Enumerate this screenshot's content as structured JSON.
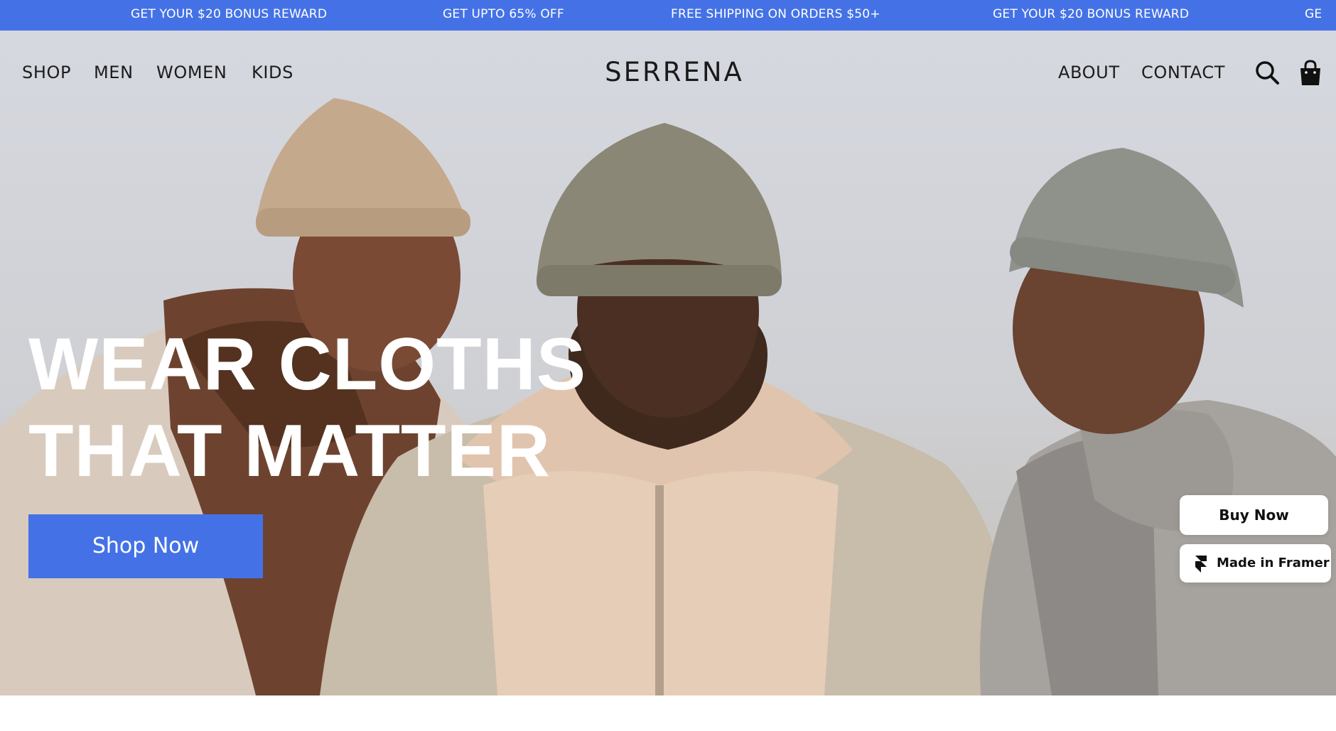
{
  "announcement_bar": {
    "messages": [
      "GET YOUR $20 BONUS REWARD",
      "GET UPTO 65% OFF",
      "FREE SHIPPING ON ORDERS $50+",
      "GET YOUR $20 BONUS REWARD",
      "GE"
    ],
    "background": "#4472e6"
  },
  "nav": {
    "left_links": [
      "SHOP",
      "MEN",
      "WOMEN",
      "KIDS"
    ],
    "brand": "SERRENA",
    "right_links": [
      "ABOUT",
      "CONTACT"
    ],
    "icons": [
      "search-icon",
      "shopping-bag-icon"
    ]
  },
  "hero": {
    "headline_line1": "WEAR CLOTHS",
    "headline_line2": "THAT MATTER",
    "cta_label": "Shop Now",
    "accent_color": "#4472e6"
  },
  "floating": {
    "buy_now_label": "Buy Now",
    "framer_label": "Made in Framer",
    "framer_icon": "framer-logo-icon"
  }
}
